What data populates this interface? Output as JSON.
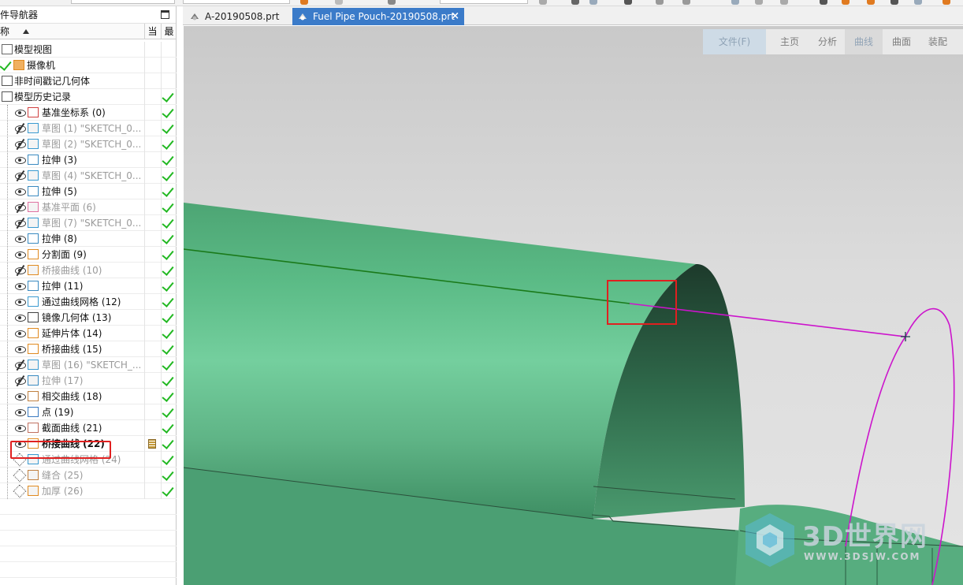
{
  "navigator": {
    "title": "件导航器",
    "columns": {
      "name": "称",
      "current": "当",
      "latest": "最"
    },
    "items": [
      {
        "label": "模型视图",
        "state": "none",
        "icon": "model-views-icon",
        "latest": false
      },
      {
        "label": "摄像机",
        "state": "check",
        "icon": "camera-icon",
        "latest": false
      },
      {
        "label": "非时间戳记几何体",
        "state": "folder",
        "icon": "folder-icon",
        "latest": false
      },
      {
        "label": "模型历史记录",
        "state": "folder",
        "icon": "folder-icon",
        "latest": true
      },
      {
        "label": "基准坐标系 (0)",
        "state": "eye",
        "icon": "datum-csys-icon",
        "latest": true,
        "dim": false
      },
      {
        "label": "草图 (1) \"SKETCH_0...",
        "state": "eye-hidden",
        "icon": "sketch-icon",
        "latest": true,
        "dim": true
      },
      {
        "label": "草图 (2) \"SKETCH_0...",
        "state": "eye-hidden",
        "icon": "sketch-icon",
        "latest": true,
        "dim": true
      },
      {
        "label": "拉伸 (3)",
        "state": "eye",
        "icon": "extrude-icon",
        "latest": true,
        "dim": false
      },
      {
        "label": "草图 (4) \"SKETCH_0...",
        "state": "eye-hidden",
        "icon": "sketch-icon",
        "latest": true,
        "dim": true
      },
      {
        "label": "拉伸 (5)",
        "state": "eye",
        "icon": "extrude-icon",
        "latest": true,
        "dim": false
      },
      {
        "label": "基准平面 (6)",
        "state": "eye-hidden",
        "icon": "datum-plane-icon",
        "latest": true,
        "dim": true
      },
      {
        "label": "草图 (7) \"SKETCH_0...",
        "state": "eye-hidden",
        "icon": "sketch-icon",
        "latest": true,
        "dim": true
      },
      {
        "label": "拉伸 (8)",
        "state": "eye",
        "icon": "extrude-icon",
        "latest": true,
        "dim": false
      },
      {
        "label": "分割面 (9)",
        "state": "eye",
        "icon": "divide-face-icon",
        "latest": true,
        "dim": false
      },
      {
        "label": "桥接曲线 (10)",
        "state": "eye-hidden",
        "icon": "bridge-curve-icon",
        "latest": true,
        "dim": true
      },
      {
        "label": "拉伸 (11)",
        "state": "eye",
        "icon": "extrude-icon",
        "latest": true,
        "dim": false
      },
      {
        "label": "通过曲线网格 (12)",
        "state": "eye",
        "icon": "curve-mesh-icon",
        "latest": true,
        "dim": false
      },
      {
        "label": "镜像几何体 (13)",
        "state": "eye",
        "icon": "mirror-geometry-icon",
        "latest": true,
        "dim": false
      },
      {
        "label": "延伸片体 (14)",
        "state": "eye",
        "icon": "extend-sheet-icon",
        "latest": true,
        "dim": false
      },
      {
        "label": "桥接曲线 (15)",
        "state": "eye",
        "icon": "bridge-curve-icon",
        "latest": true,
        "dim": false
      },
      {
        "label": "草图 (16) \"SKETCH_...",
        "state": "eye-hidden",
        "icon": "sketch-icon",
        "latest": true,
        "dim": true
      },
      {
        "label": "拉伸 (17)",
        "state": "eye-hidden",
        "icon": "extrude-icon",
        "latest": true,
        "dim": true
      },
      {
        "label": "相交曲线 (18)",
        "state": "eye",
        "icon": "intersection-curve-icon",
        "latest": true,
        "dim": false
      },
      {
        "label": "点 (19)",
        "state": "eye",
        "icon": "point-icon",
        "latest": true,
        "dim": false
      },
      {
        "label": "截面曲线 (21)",
        "state": "eye",
        "icon": "section-curve-icon",
        "latest": true,
        "dim": false
      },
      {
        "label": "桥接曲线 (22)",
        "state": "eye",
        "icon": "bridge-curve-icon",
        "latest": true,
        "dim": false,
        "current": true,
        "bold": true
      },
      {
        "label": "通过曲线网格 (24)",
        "state": "suppressed",
        "icon": "curve-mesh-icon",
        "latest": true,
        "dim": true
      },
      {
        "label": "缝合 (25)",
        "state": "suppressed",
        "icon": "sew-icon",
        "latest": true,
        "dim": true
      },
      {
        "label": "加厚 (26)",
        "state": "suppressed",
        "icon": "thicken-icon",
        "latest": true,
        "dim": true
      }
    ]
  },
  "tabs": [
    {
      "label": "A-20190508.prt",
      "active": false
    },
    {
      "label": "Fuel Pipe Pouch-20190508.prt",
      "active": true,
      "close": "×"
    }
  ],
  "ribbon": {
    "file": "文件(F)",
    "home": "主页",
    "analysis": "分析",
    "curve": "曲线",
    "surface": "曲面",
    "assembly": "装配"
  },
  "watermark": {
    "brand": "3D世界网",
    "url": "WWW.3DSJW.COM"
  },
  "colors": {
    "tab_active": "#3b7bc9",
    "check": "#22b822",
    "highlight": "#e02020",
    "model_green": "#5fbf8c",
    "curve_magenta": "#cc14cc",
    "curve_green": "#1a7a1a"
  }
}
